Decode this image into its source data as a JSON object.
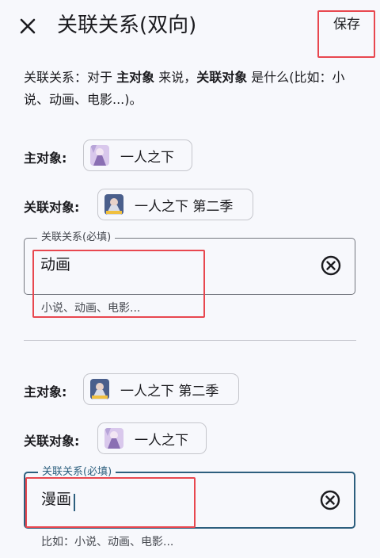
{
  "header": {
    "title": "关联关系(双向)",
    "save_label": "保存",
    "close_icon": "close-icon"
  },
  "description": {
    "part1": "关联关系：对于 ",
    "main_object": "主对象",
    "part2": " 来说，",
    "related_object": "关联对象",
    "part3": " 是什么(比如：小说、动画、电影...)。"
  },
  "relations": [
    {
      "main_label": "主对象:",
      "main_title": "一人之下",
      "related_label": "关联对象:",
      "related_title": "一人之下 第二季",
      "field_label": "关联关系(必填)",
      "field_value": "动画",
      "support_text": "小说、动画、电影..."
    },
    {
      "main_label": "主对象:",
      "main_title": "一人之下 第二季",
      "related_label": "关联对象:",
      "related_title": "一人之下",
      "field_label": "关联关系(必填)",
      "field_value": "漫画",
      "support_text": "比如：小说、动画、电影..."
    }
  ],
  "colors": {
    "background": "#f7f8fc",
    "focus_outline": "#2d5f7e",
    "highlight_box": "#e8474f"
  }
}
